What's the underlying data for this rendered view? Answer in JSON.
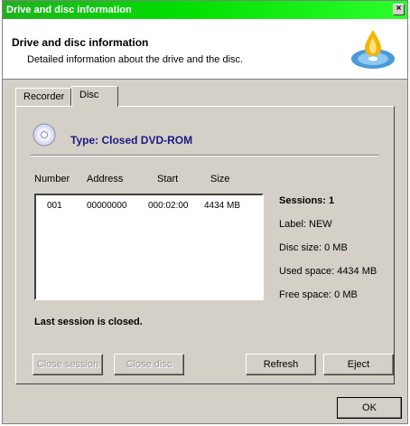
{
  "window": {
    "title": "Drive and disc information"
  },
  "header": {
    "title": "Drive and disc information",
    "subtitle": "Detailed information about the drive and the disc."
  },
  "tabs": [
    {
      "label": "Recorder",
      "active": false
    },
    {
      "label": "Disc",
      "active": true
    }
  ],
  "disc": {
    "type_label": "Type: Closed DVD-ROM",
    "columns": [
      "Number",
      "Address",
      "Start",
      "Size"
    ],
    "rows": [
      {
        "number": "001",
        "address": "00000000",
        "start": "000:02:00",
        "size": "4434 MB"
      }
    ],
    "sessions": "Sessions: 1",
    "label": "Label: NEW",
    "disc_size": "Disc size: 0 MB",
    "used_space": "Used space: 4434 MB",
    "free_space": "Free space: 0 MB",
    "last_session": "Last session is closed."
  },
  "buttons": {
    "close_session": "Close session",
    "close_disc": "Close disc",
    "refresh": "Refresh",
    "eject": "Eject",
    "ok": "OK"
  },
  "colors": {
    "titlebar": "#1fb21f",
    "type_label": "#1a1a80",
    "dialog_bg": "#d4d0c8"
  }
}
